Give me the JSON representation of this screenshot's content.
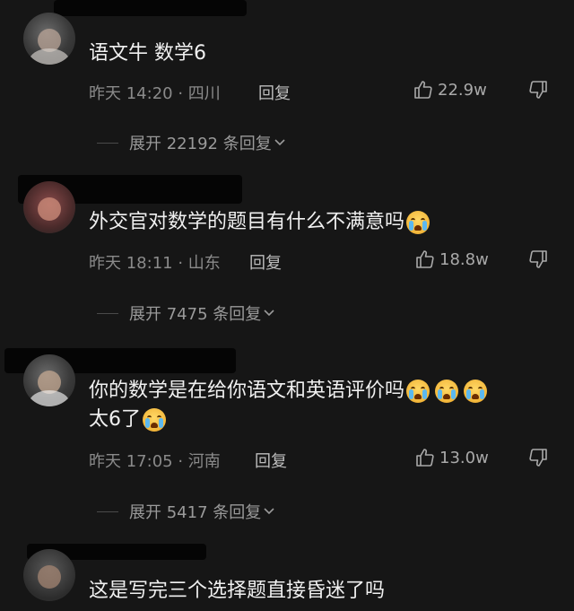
{
  "comments": [
    {
      "text": "语文牛  数学6",
      "time_location": "昨天 14:20 · 四川",
      "reply_label": "回复",
      "likes": "22.9w",
      "expand": "展开 22192 条回复"
    },
    {
      "text": "外交官对数学的题目有什么不满意吗",
      "time_location": "昨天 18:11 · 山东",
      "reply_label": "回复",
      "likes": "18.8w",
      "expand": "展开 7475 条回复"
    },
    {
      "text": "你的数学是在给你语文和英语评价吗",
      "text_line2": "太6了",
      "time_location": "昨天 17:05 · 河南",
      "reply_label": "回复",
      "likes": "13.0w",
      "expand": "展开 5417 条回复"
    },
    {
      "text": "这是写完三个选择题直接昏迷了吗"
    }
  ],
  "icons": {
    "like": "thumbs-up-icon",
    "dislike": "thumbs-down-icon",
    "expand": "chevron-down-icon",
    "emoji": "crying-face-emoji"
  },
  "colors": {
    "background": "#161616",
    "text": "#f0f0f0",
    "meta": "#8a8a8a",
    "emoji": "#f2b63a"
  }
}
